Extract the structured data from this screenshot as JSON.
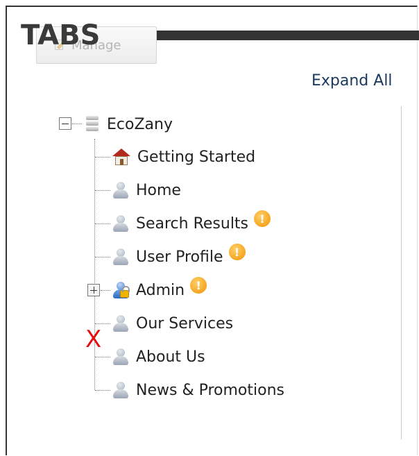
{
  "header": {
    "title": "TABS",
    "manage_label": "Manage"
  },
  "toolbar": {
    "expand_all": "Expand All"
  },
  "tree": {
    "root": {
      "label": "EcoZany",
      "icon": "database-icon",
      "expanded": true
    },
    "children": [
      {
        "label": "Getting Started",
        "icon": "home-icon",
        "warning": false,
        "expandable": false
      },
      {
        "label": "Home",
        "icon": "user-icon",
        "warning": false,
        "expandable": false
      },
      {
        "label": "Search Results",
        "icon": "user-icon",
        "warning": true,
        "expandable": false
      },
      {
        "label": "User Profile",
        "icon": "user-icon",
        "warning": true,
        "expandable": false
      },
      {
        "label": "Admin",
        "icon": "admin-user-icon",
        "warning": true,
        "expandable": true,
        "expanded": false
      },
      {
        "label": "Our Services",
        "icon": "user-icon",
        "warning": false,
        "expandable": false
      },
      {
        "label": "About Us",
        "icon": "user-icon",
        "warning": false,
        "expandable": false
      },
      {
        "label": "News & Promotions",
        "icon": "user-icon",
        "warning": false,
        "expandable": false
      }
    ],
    "warning_glyph": "!"
  },
  "annotation": {
    "mark": "X",
    "color": "#e01010"
  }
}
